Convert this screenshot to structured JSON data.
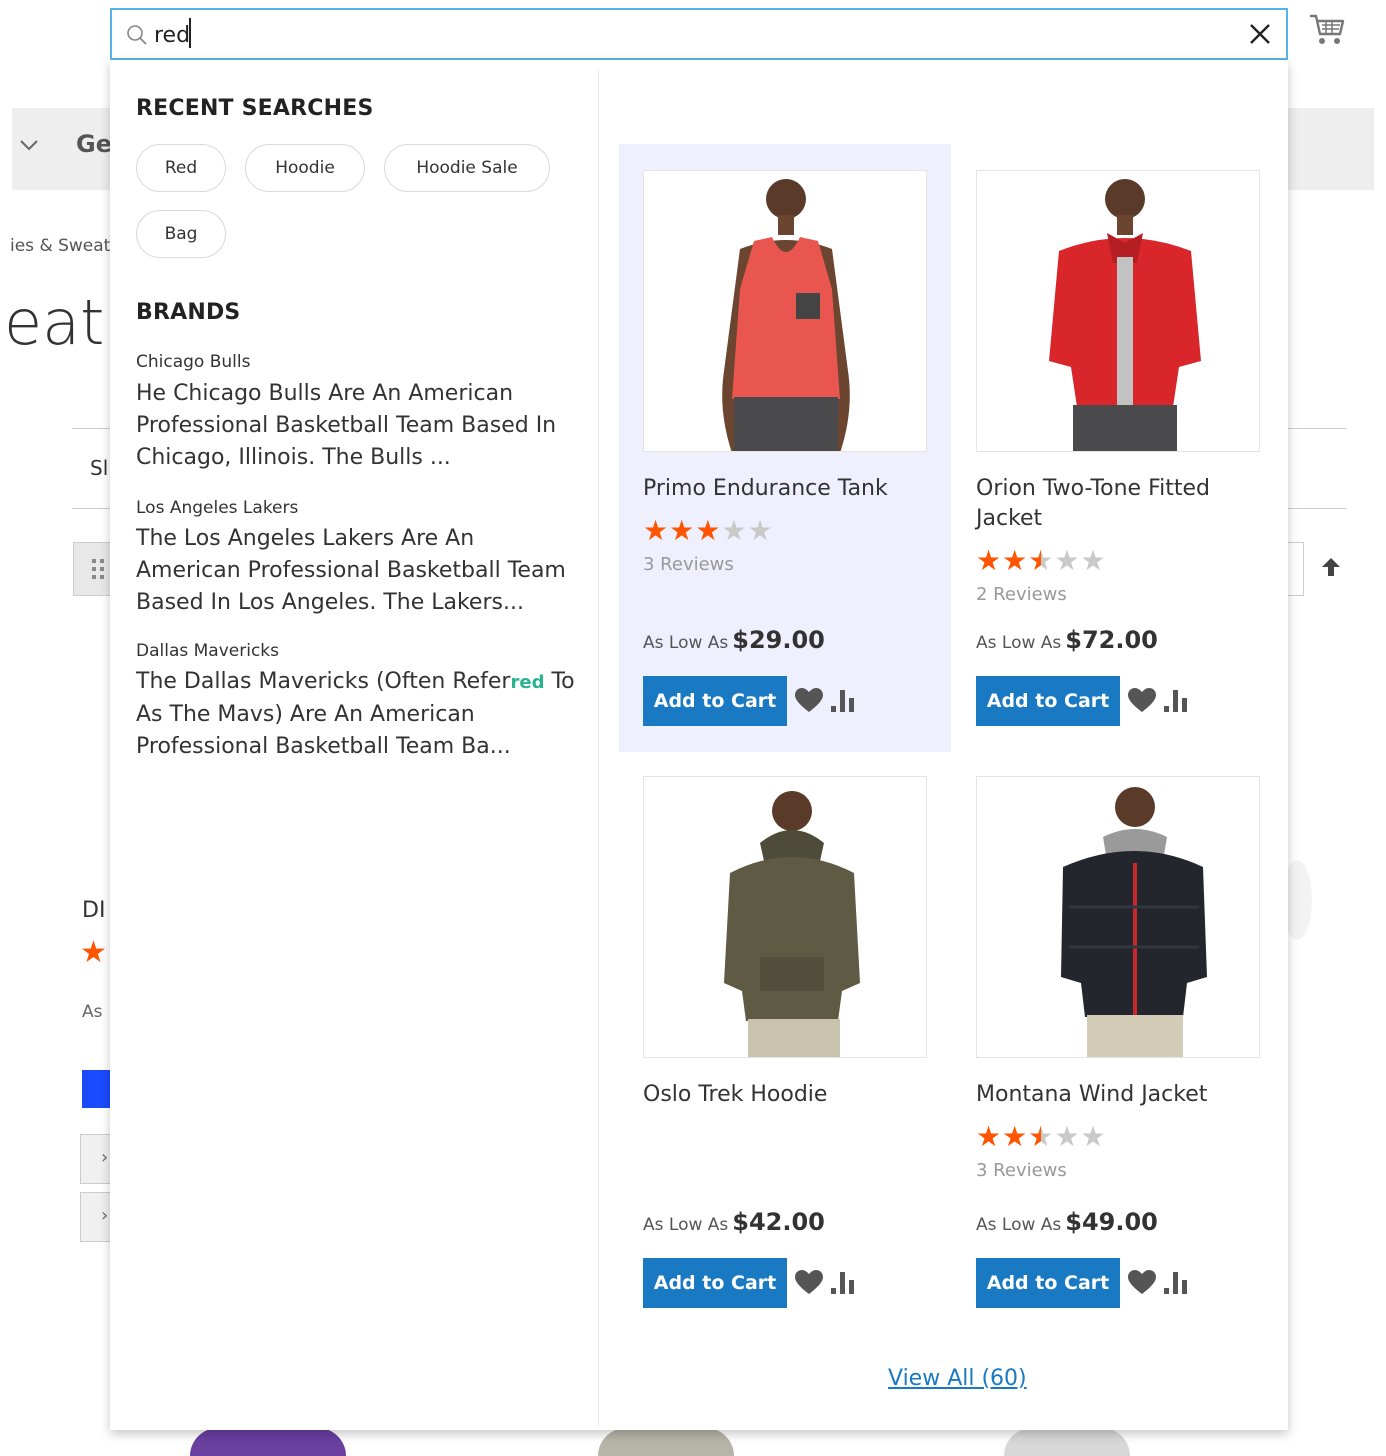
{
  "search": {
    "value": "red",
    "placeholder": ""
  },
  "background": {
    "nav_text": "Ge",
    "breadcrumb": "ies & Sweat",
    "heading": "eat",
    "filter_text": "Sl",
    "item_name": "DI",
    "item_price": "As"
  },
  "recent_searches": {
    "title": "RECENT SEARCHES",
    "items": [
      "Red",
      "Hoodie",
      "Hoodie Sale",
      "Bag"
    ]
  },
  "brands": {
    "title": "BRANDS",
    "items": [
      {
        "name": "Chicago Bulls",
        "description": "He Chicago Bulls Are An American Professional Basketball Team Based In Chicago, Illinois. The Bulls ..."
      },
      {
        "name": "Los Angeles Lakers",
        "description": "The Los Angeles Lakers Are An American Professional Basketball Team Based In Los Angeles. The Lakers..."
      },
      {
        "name": "Dallas Mavericks",
        "description_pre": "The Dallas Mavericks (Often Refer",
        "description_hl": "red",
        "description_post": " To As The Mavs) Are An American Professional Basketball Team Ba..."
      }
    ]
  },
  "products": [
    {
      "name": "Primo Endurance Tank",
      "rating_stars": 3,
      "reviews": "3 Reviews",
      "price_label": "As Low As",
      "price": "$29.00",
      "button": "Add to Cart",
      "shirt_color": "#e8564f"
    },
    {
      "name": "Orion Two-Tone Fitted Jacket",
      "rating_stars": 2.5,
      "reviews": "2 Reviews",
      "price_label": "As Low As",
      "price": "$72.00",
      "button": "Add to Cart",
      "shirt_color": "#d9262a"
    },
    {
      "name": "Oslo Trek Hoodie",
      "rating_stars": 0,
      "reviews": "",
      "price_label": "As Low As",
      "price": "$42.00",
      "button": "Add to Cart",
      "shirt_color": "#5e5a44"
    },
    {
      "name": "Montana Wind Jacket",
      "rating_stars": 2.5,
      "reviews": "3 Reviews",
      "price_label": "As Low As",
      "price": "$49.00",
      "button": "Add to Cart",
      "shirt_color": "#23262d"
    }
  ],
  "view_all": "View All (60)",
  "colors": {
    "accent": "#1979c3",
    "star": "#ff5501",
    "search_border": "#57b3e8",
    "highlight_card": "#eef0fd",
    "match_highlight": "#2ab38f"
  },
  "icons": [
    "search-icon",
    "close-icon",
    "cart-icon",
    "heart-icon",
    "compare-icon",
    "chevron-down-icon",
    "arrow-up-icon",
    "grid-icon"
  ]
}
